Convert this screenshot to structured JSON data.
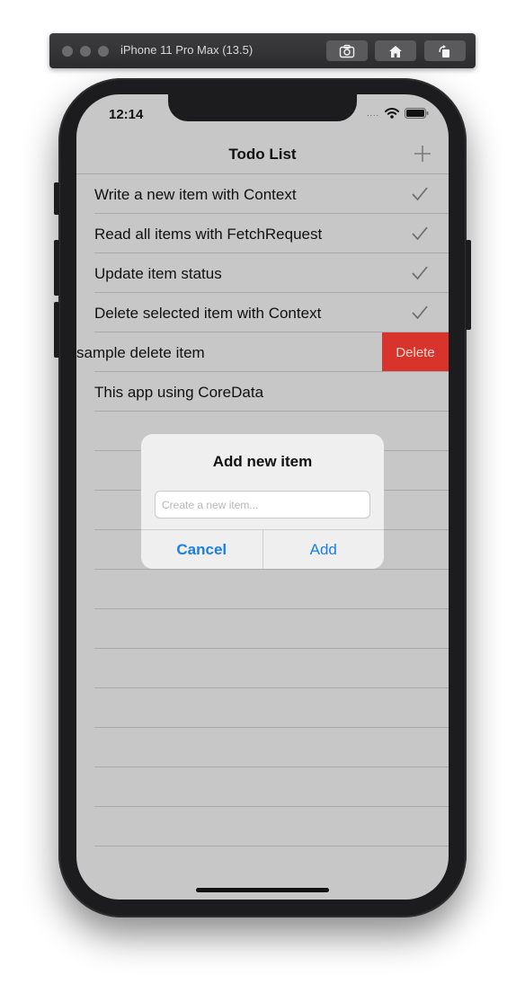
{
  "simulator": {
    "title": "iPhone 11 Pro Max (13.5)",
    "buttons": [
      "screenshot-icon",
      "home-icon",
      "rotate-icon"
    ]
  },
  "status_bar": {
    "time": "12:14",
    "signal": "....",
    "icons": [
      "wifi-icon",
      "battery-icon"
    ]
  },
  "navbar": {
    "title": "Todo List",
    "add_icon": "plus-icon"
  },
  "items": [
    {
      "label": "Write a new item with Context",
      "checked": true
    },
    {
      "label": "Read all items with FetchRequest",
      "checked": true
    },
    {
      "label": "Update item status",
      "checked": true
    },
    {
      "label": "Delete selected item with Context",
      "checked": true
    },
    {
      "label": "sample delete item",
      "checked": false,
      "swiped": true,
      "action": "Delete"
    },
    {
      "label": "This app using CoreData",
      "checked": false
    }
  ],
  "alert": {
    "title": "Add new item",
    "input_value": "",
    "input_placeholder": "Create a new item...",
    "cancel_label": "Cancel",
    "add_label": "Add"
  },
  "colors": {
    "accent": "#1a7ee6",
    "destructive": "#d8342b",
    "dimmed_background": "#c7c7c7"
  }
}
